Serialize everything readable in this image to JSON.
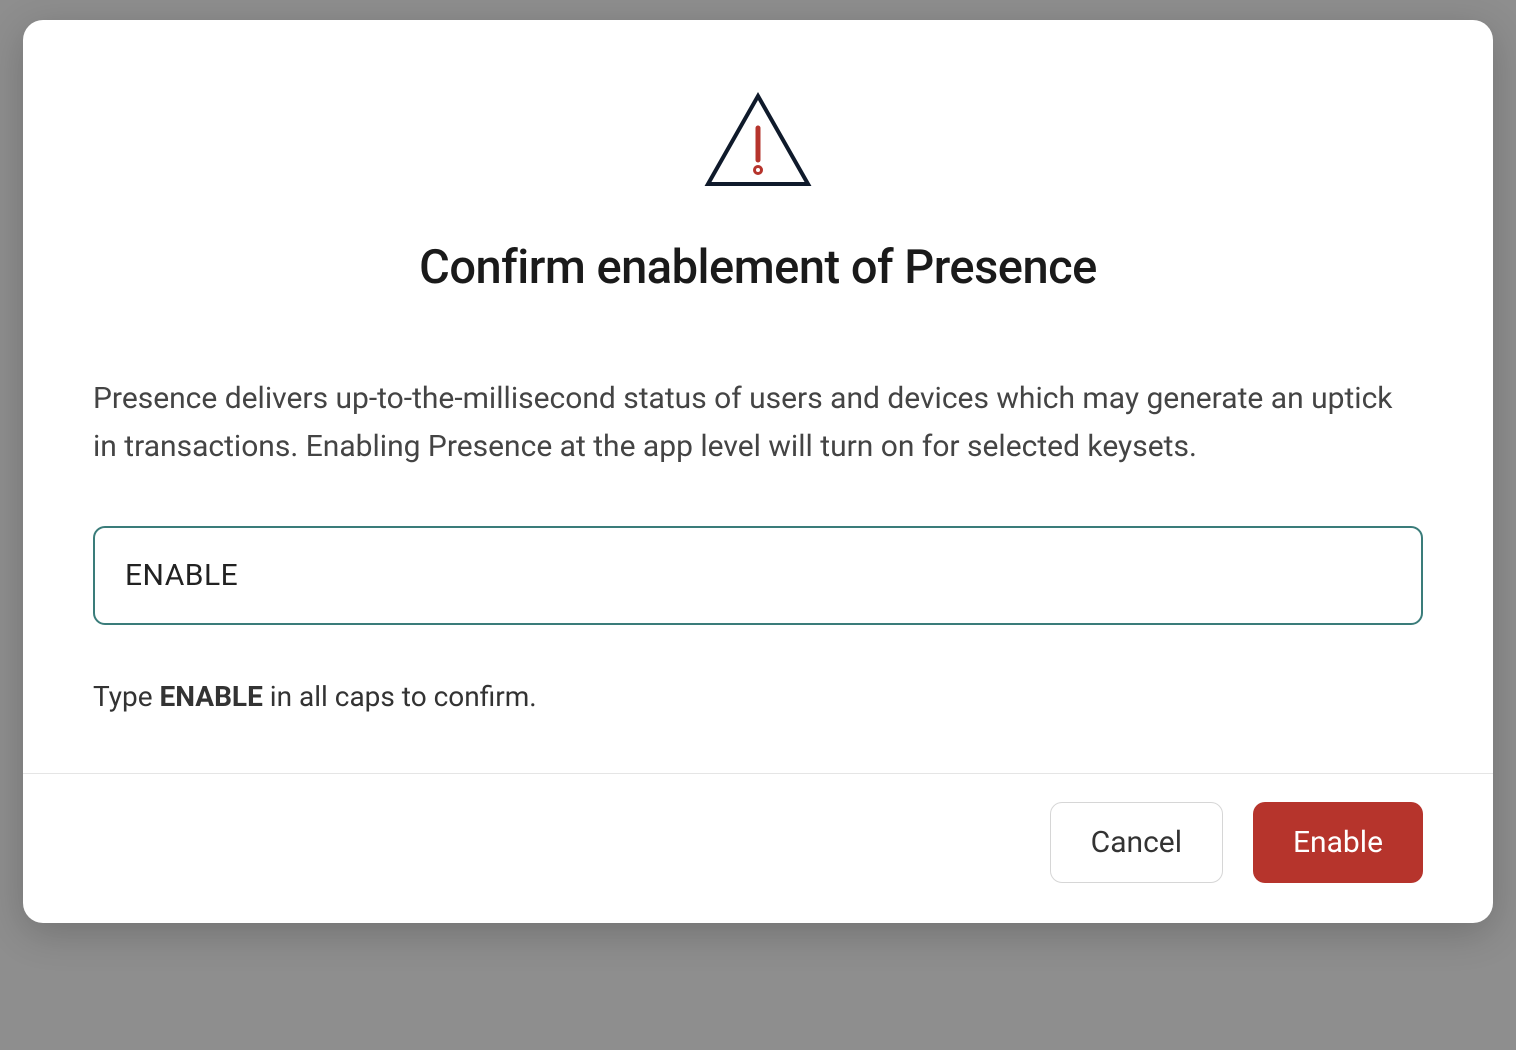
{
  "modal": {
    "title": "Confirm enablement of Presence",
    "description": "Presence delivers up-to-the-millisecond status of users and devices which may generate an uptick in transactions. Enabling Presence at the app level will turn on for selected keysets.",
    "input_value": "ENABLE",
    "hint_prefix": "Type ",
    "hint_bold": "ENABLE",
    "hint_suffix": " in all caps to confirm.",
    "cancel_label": "Cancel",
    "enable_label": "Enable"
  },
  "colors": {
    "danger": "#b6342c",
    "input_border": "#3a7c7a"
  }
}
